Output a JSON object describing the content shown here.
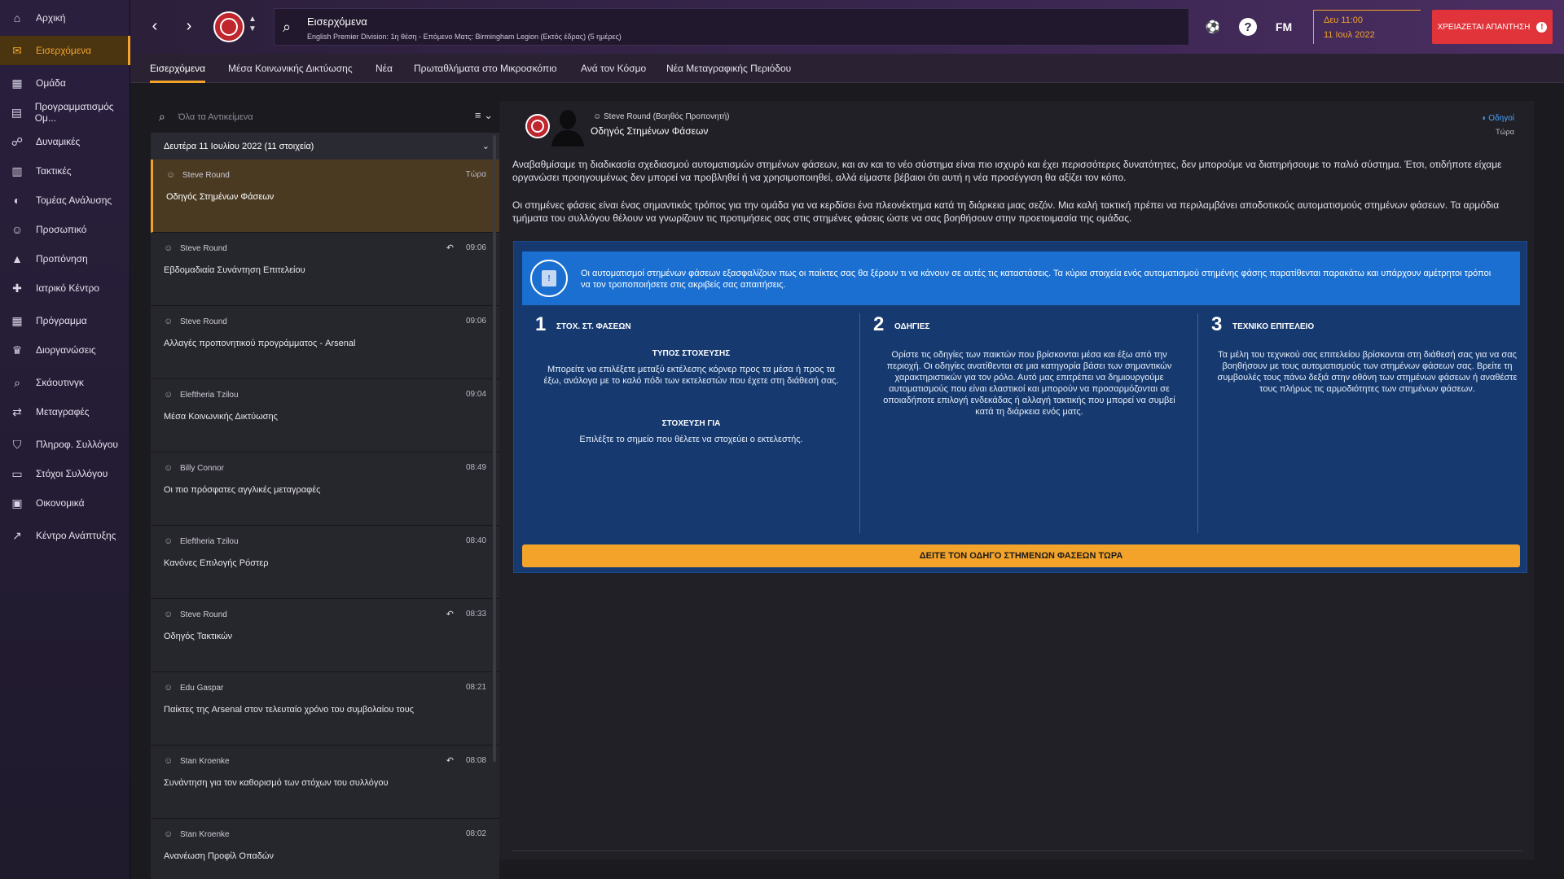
{
  "sidebar": {
    "items": [
      {
        "label": "Αρχική",
        "icon": "home-icon",
        "glyph": "⌂"
      },
      {
        "label": "Εισερχόμενα",
        "icon": "inbox-icon",
        "glyph": "✉",
        "active": true
      },
      {
        "label": "Ομάδα",
        "icon": "shirt-icon",
        "glyph": "▦"
      },
      {
        "label": "Προγραμματισμός Ομ...",
        "icon": "clipboard-icon",
        "glyph": "▤"
      },
      {
        "label": "Δυναμικές",
        "icon": "people-icon",
        "glyph": "☍"
      },
      {
        "label": "Τακτικές",
        "icon": "tactics-icon",
        "glyph": "▥"
      },
      {
        "label": "Τομέας Ανάλυσης",
        "icon": "analysis-icon",
        "glyph": "◐"
      },
      {
        "label": "Προσωπικό",
        "icon": "staff-icon",
        "glyph": "☺"
      },
      {
        "label": "Προπόνηση",
        "icon": "training-icon",
        "glyph": "▲"
      },
      {
        "label": "Ιατρικό Κέντρο",
        "icon": "medical-icon",
        "glyph": "✚"
      },
      {
        "label": "Πρόγραμμα",
        "icon": "calendar-icon",
        "glyph": "▦"
      },
      {
        "label": "Διοργανώσεις",
        "icon": "trophy-icon",
        "glyph": "♛"
      },
      {
        "label": "Σκάουτινγκ",
        "icon": "scouting-icon",
        "glyph": "⌕"
      },
      {
        "label": "Μεταγραφές",
        "icon": "transfers-icon",
        "glyph": "⇄"
      },
      {
        "label": "Πληροφ. Συλλόγου",
        "icon": "shield-icon",
        "glyph": "⛉"
      },
      {
        "label": "Στόχοι Συλλόγου",
        "icon": "briefcase-icon",
        "glyph": "▭"
      },
      {
        "label": "Οικονομικά",
        "icon": "finance-icon",
        "glyph": "▣"
      },
      {
        "label": "Κέντρο Ανάπτυξης",
        "icon": "development-icon",
        "glyph": "↗"
      }
    ]
  },
  "header": {
    "search_title": "Εισερχόμενα",
    "search_subtitle": "English Premier Division: 1η θέση - Επόμενο Ματς: Birmingham Legion (Εκτός έδρας) (5 ημέρες)",
    "fm_label": "FM",
    "date_time": "Δευ 11:00",
    "date": "11 Ιουλ 2022",
    "reply_button": "ΧΡΕΙΑΖΕΤΑΙ ΑΠΑΝΤΗΣΗ",
    "reply_excl": "!"
  },
  "tabs": [
    {
      "label": "Εισερχόμενα",
      "active": true
    },
    {
      "label": "Μέσα Κοινωνικής Δικτύωσης"
    },
    {
      "label": "Νέα"
    },
    {
      "label": "Πρωταθλήματα στο Μικροσκόπιο"
    },
    {
      "label": "Ανά τον Κόσμο"
    },
    {
      "label": "Νέα Μεταγραφικής Περιόδου"
    }
  ],
  "inbox": {
    "filter_placeholder": "Όλα τα Αντικείμενα",
    "group_label": "Δευτέρα 11 Ιουλίου 2022 (11 στοιχεία)",
    "messages": [
      {
        "sender": "Steve Round",
        "time": "Τώρα",
        "subject": "Οδηγός Στημένων Φάσεων",
        "selected": true,
        "replied": false
      },
      {
        "sender": "Steve Round",
        "time": "09:06",
        "subject": "Εβδομαδιαία Συνάντηση Επιτελείου",
        "replied": true
      },
      {
        "sender": "Steve Round",
        "time": "09:06",
        "subject": "Αλλαγές προπονητικού προγράμματος - Arsenal",
        "replied": false
      },
      {
        "sender": "Eleftheria Tzilou",
        "time": "09:04",
        "subject": "Μέσα Κοινωνικής Δικτύωσης",
        "replied": false
      },
      {
        "sender": "Billy Connor",
        "time": "08:49",
        "subject": "Οι πιο πρόσφατες αγγλικές μεταγραφές",
        "replied": false
      },
      {
        "sender": "Eleftheria Tzilou",
        "time": "08:40",
        "subject": "Κανόνες Επιλογής Ρόστερ",
        "replied": false
      },
      {
        "sender": "Steve Round",
        "time": "08:33",
        "subject": "Οδηγός Τακτικών",
        "replied": true
      },
      {
        "sender": "Edu Gaspar",
        "time": "08:21",
        "subject": "Παίκτες της Arsenal στον τελευταίο χρόνο του συμβολαίου τους",
        "replied": false
      },
      {
        "sender": "Stan Kroenke",
        "time": "08:08",
        "subject": "Συνάντηση για τον καθορισμό των στόχων του συλλόγου",
        "replied": true
      },
      {
        "sender": "Stan Kroenke",
        "time": "08:02",
        "subject": "Ανανέωση Προφίλ Οπαδών",
        "replied": false
      }
    ]
  },
  "message": {
    "from": "Steve Round  (Βοηθός Προπονητή)",
    "subject": "Οδηγός Στημένων Φάσεων",
    "tag": "Οδηγοί",
    "time": "Τώρα",
    "paragraphs": [
      "Αναβαθμίσαμε τη διαδικασία σχεδιασμού αυτοματισμών στημένων φάσεων, και αν και το νέο σύστημα είναι πιο ισχυρό και έχει περισσότερες δυνατότητες, δεν μπορούμε να διατηρήσουμε το παλιό σύστημα. Έτσι, οτιδήποτε είχαμε οργανώσει προηγουμένως δεν μπορεί να προβληθεί ή να χρησιμοποιηθεί, αλλά είμαστε βέβαιοι ότι αυτή η νέα προσέγγιση θα αξίζει τον κόπο.",
      "Οι στημένες φάσεις είναι ένας σημαντικός τρόπος για την ομάδα για να κερδίσει ένα πλεονέκτημα κατά τη διάρκεια μιας σεζόν. Μια καλή τακτική πρέπει να περιλαμβάνει αποδοτικούς αυτοματισμούς στημένων φάσεων. Τα αρμόδια τμήματα του συλλόγου θέλουν να γνωρίζουν τις προτιμήσεις σας στις στημένες φάσεις ώστε να σας βοηθήσουν στην προετοιμασία της ομάδας."
    ],
    "info_text": "Οι αυτοματισμοί στημένων φάσεων εξασφαλίζουν πως οι παίκτες σας θα ξέρουν τι να κάνουν σε αυτές τις καταστάσεις. Τα κύρια στοιχεία ενός αυτοματισμού στημένης φάσης παρατίθενται παρακάτω και υπάρχουν αμέτρητοι τρόποι να τον τροποποιήσετε στις ακριβείς σας απαιτήσεις.",
    "columns": [
      {
        "num": "1",
        "title": "ΣΤΟΧ. ΣΤ. ΦΑΣΕΩΝ",
        "sub1": "ΤΥΠΟΣ ΣΤΟΧΕΥΣΗΣ",
        "text1": "Μπορείτε να επιλέξετε μεταξύ εκτέλεσης κόρνερ προς τα μέσα ή προς τα έξω, ανάλογα με το καλό πόδι των εκτελεστών που έχετε στη διάθεσή σας.",
        "sub2": "ΣΤΟΧΕΥΣΗ ΓΙΑ",
        "text2": "Επιλέξτε το σημείο που θέλετε να στοχεύει ο εκτελεστής."
      },
      {
        "num": "2",
        "title": "ΟΔΗΓΙΕΣ",
        "text1": "Ορίστε τις οδηγίες των παικτών που βρίσκονται μέσα και έξω από την περιοχή. Οι οδηγίες ανατίθενται σε μια κατηγορία βάσει των σημαντικών χαρακτηριστικών για τον ρόλο. Αυτό μας επιτρέπει να δημιουργούμε αυτοματισμούς που είναι ελαστικοί και μπορούν να προσαρμόζονται σε οποιαδήποτε επιλογή ενδεκάδας ή αλλαγή τακτικής που μπορεί να συμβεί κατά τη διάρκεια ενός ματς."
      },
      {
        "num": "3",
        "title": "ΤΕΧΝΙΚΟ ΕΠΙΤΕΛΕΙΟ",
        "text1": "Τα μέλη του τεχνικού σας επιτελείου βρίσκονται στη διάθεσή σας για να σας βοηθήσουν με τους αυτοματισμούς των στημένων φάσεων σας. Βρείτε τη συμβουλές τους πάνω δεξιά στην οθόνη των στημένων φάσεων ή αναθέστε τους πλήρως τις αρμοδιότητες των στημένων φάσεων."
      }
    ],
    "guide_button": "ΔΕΙΤΕ ΤΟΝ ΟΔΗΓΟ ΣΤΗΜΕΝΩΝ ΦΑΣΕΩΝ ΤΩΡΑ"
  },
  "colors": {
    "accent": "#f3a32a",
    "alert": "#e0343a",
    "info_blue": "#1a6fd0",
    "card_blue": "#163a70",
    "club_red": "#c0262d"
  }
}
